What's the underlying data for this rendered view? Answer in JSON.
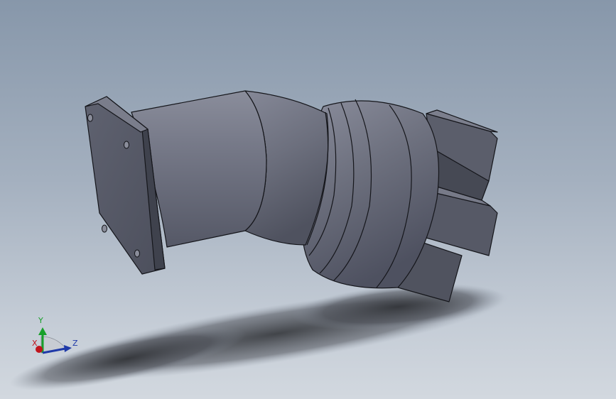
{
  "viewport": {
    "background_top": "#8797aa",
    "background_bottom": "#d2d8df",
    "model_color": "#6d707e"
  },
  "triad": {
    "x_label": "X",
    "y_label": "Y",
    "z_label": "Z",
    "x_color": "#c0141c",
    "y_color": "#18a02a",
    "z_color": "#1f3aa8"
  }
}
